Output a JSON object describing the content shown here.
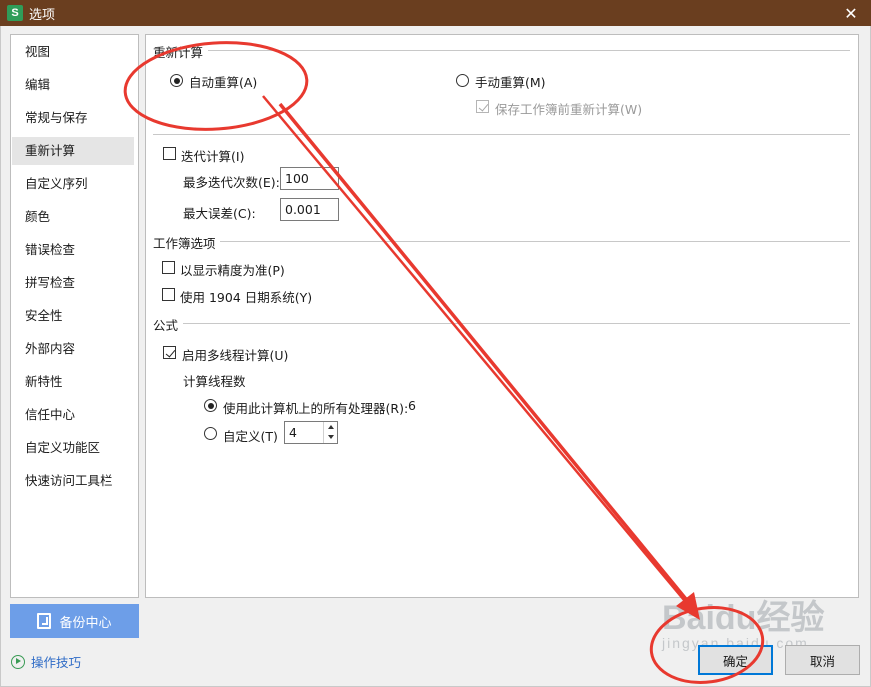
{
  "window": {
    "title": "选项",
    "app_icon_letter": "S",
    "close_glyph": "✕"
  },
  "sidebar": {
    "items": [
      {
        "label": "视图",
        "active": false
      },
      {
        "label": "编辑",
        "active": false
      },
      {
        "label": "常规与保存",
        "active": false
      },
      {
        "label": "重新计算",
        "active": true
      },
      {
        "label": "自定义序列",
        "active": false
      },
      {
        "label": "颜色",
        "active": false
      },
      {
        "label": "错误检查",
        "active": false
      },
      {
        "label": "拼写检查",
        "active": false
      },
      {
        "label": "安全性",
        "active": false
      },
      {
        "label": "外部内容",
        "active": false
      },
      {
        "label": "新特性",
        "active": false
      },
      {
        "label": "信任中心",
        "active": false
      },
      {
        "label": "自定义功能区",
        "active": false
      },
      {
        "label": "快速访问工具栏",
        "active": false
      }
    ],
    "backup_label": "备份中心",
    "tips_label": "操作技巧"
  },
  "recalc": {
    "section_title": "重新计算",
    "auto_label": "自动重算(A)",
    "auto_checked": true,
    "manual_label": "手动重算(M)",
    "manual_checked": false,
    "save_before_label": "保存工作簿前重新计算(W)",
    "save_before_checked": true,
    "iteration_label": "迭代计算(I)",
    "iteration_checked": false,
    "max_iter_label": "最多迭代次数(E):",
    "max_iter_value": "100",
    "max_change_label": "最大误差(C):",
    "max_change_value": "0.001"
  },
  "workbook": {
    "section_title": "工作簿选项",
    "precision_label": "以显示精度为准(P)",
    "precision_checked": false,
    "date1904_label": "使用 1904 日期系统(Y)",
    "date1904_checked": false
  },
  "formula": {
    "section_title": "公式",
    "multithread_label": "启用多线程计算(U)",
    "multithread_checked": true,
    "threads_title": "计算线程数",
    "use_all_label": "使用此计算机上的所有处理器(R):",
    "use_all_count": "6",
    "use_all_checked": true,
    "custom_label": "自定义(T)",
    "custom_checked": false,
    "custom_value": "4"
  },
  "buttons": {
    "ok_label": "确定",
    "cancel_label": "取消"
  },
  "watermark": {
    "text": "Baidu经验",
    "sub": "jingyan.baidu.com"
  },
  "colors": {
    "titlebar": "#6a3e1f",
    "annotation": "#e8392f",
    "backup_button": "#6d9ee8",
    "link": "#2e6bc6"
  }
}
